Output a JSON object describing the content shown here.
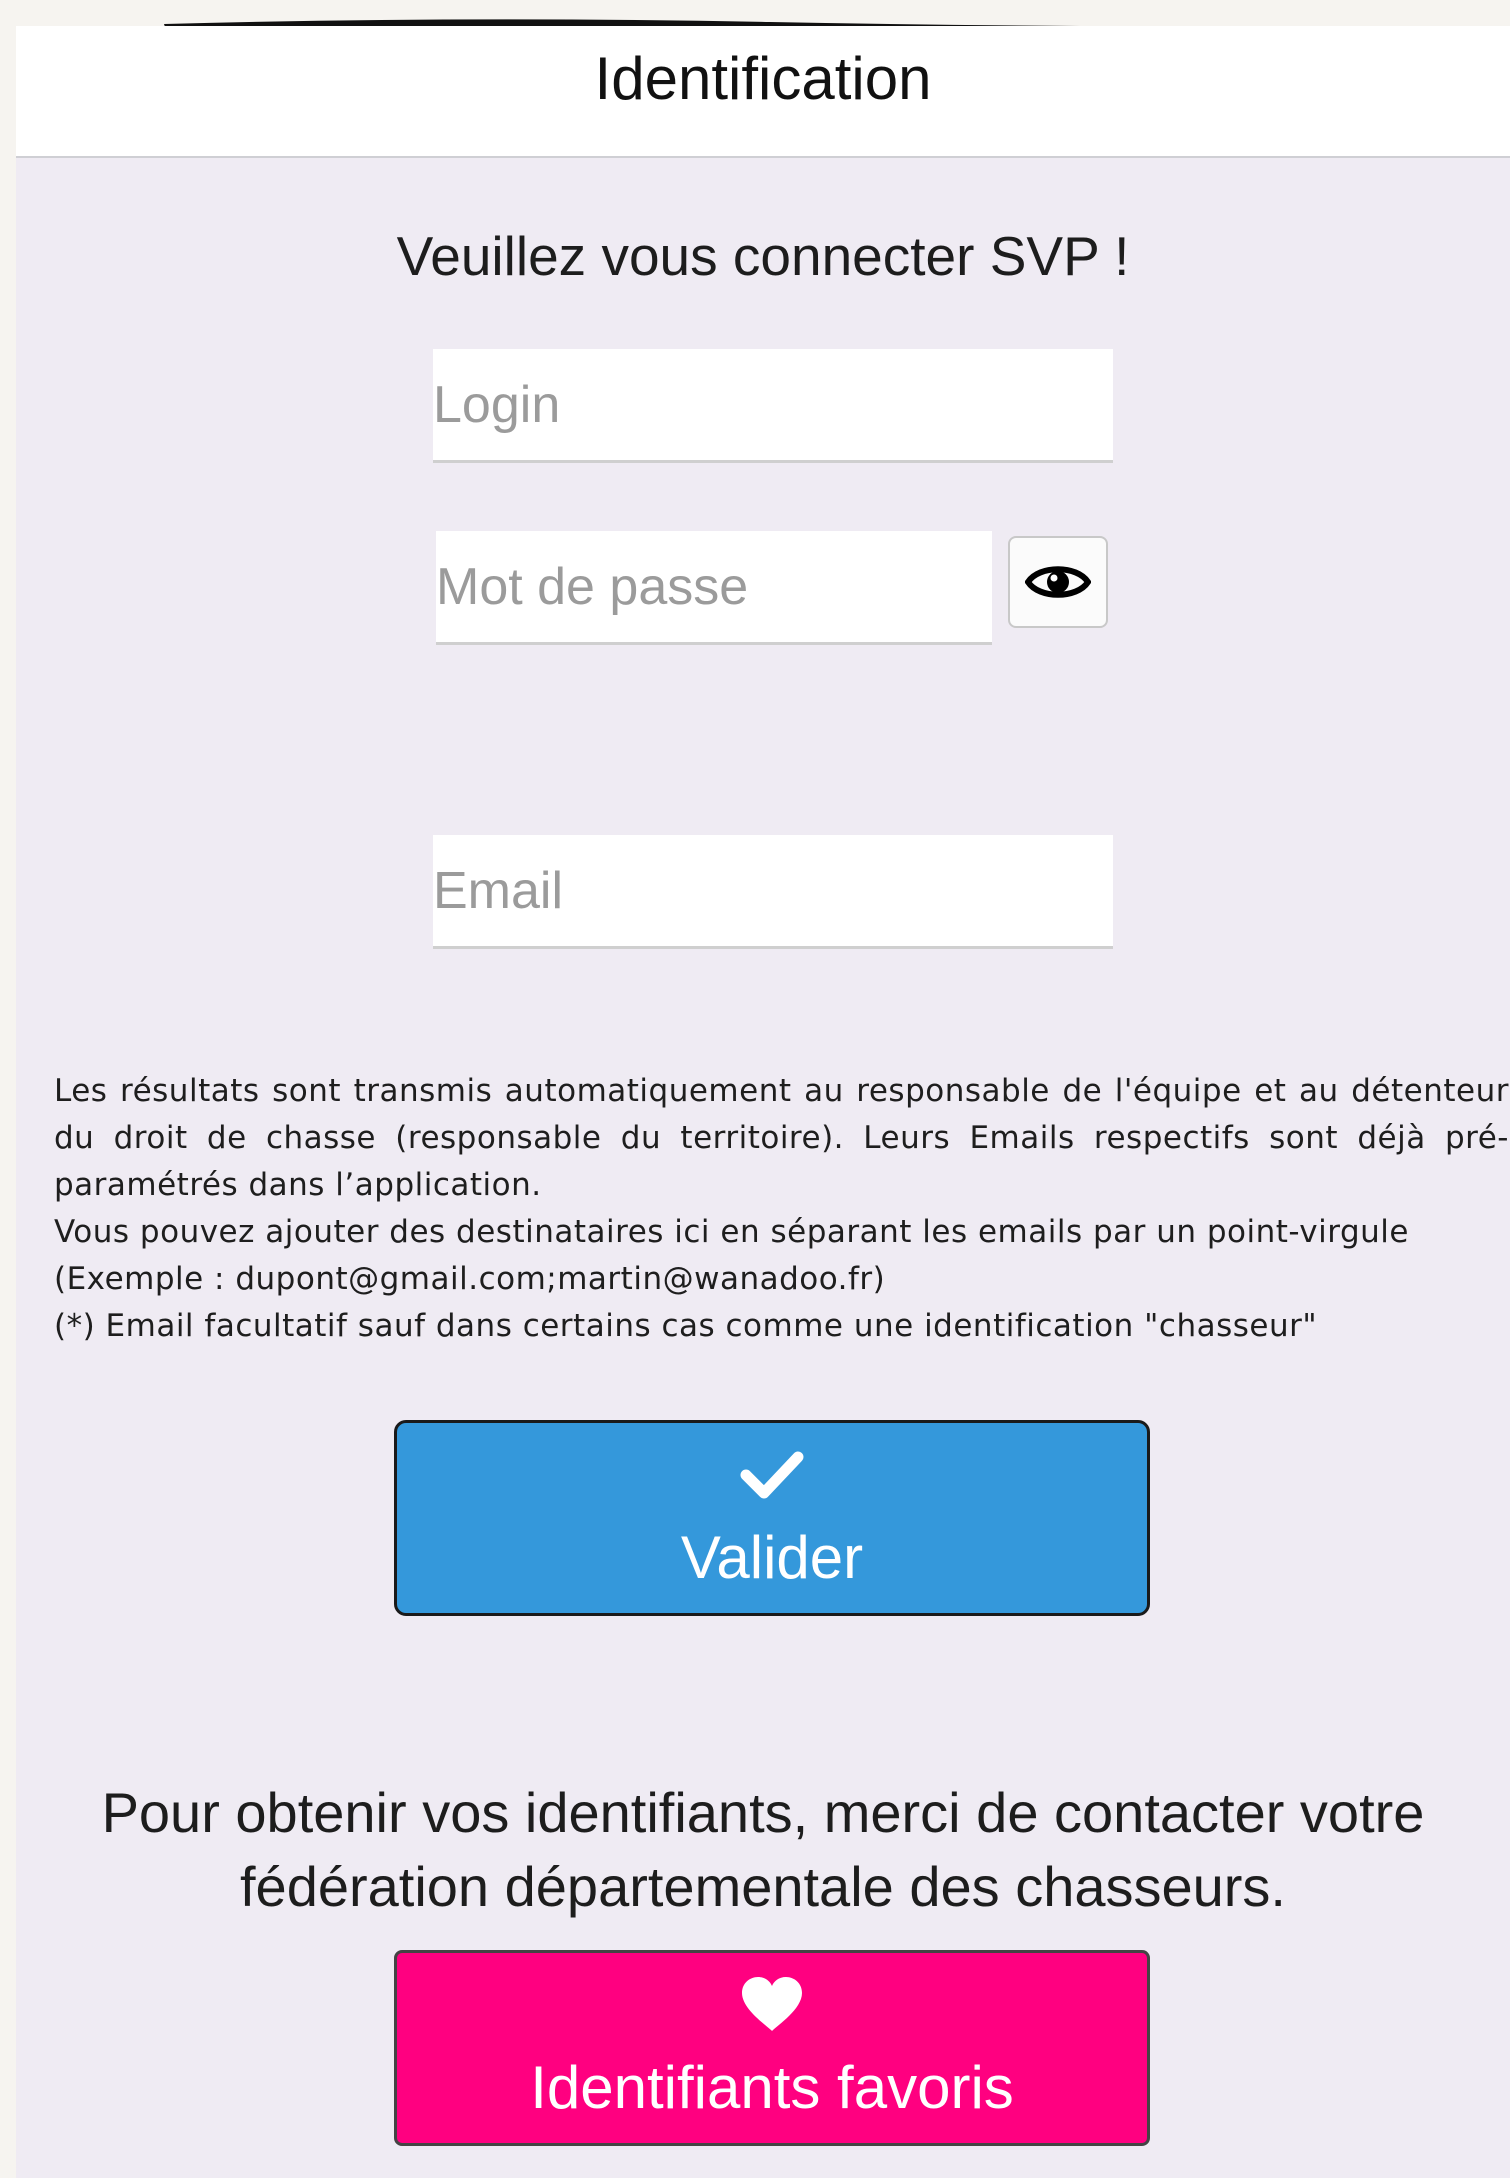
{
  "header": {
    "title": "Identification"
  },
  "form": {
    "prompt": "Veuillez vous connecter SVP !",
    "login_placeholder": "Login",
    "password_placeholder": "Mot de passe",
    "email_placeholder": "Email",
    "show_password_icon": "eye-icon"
  },
  "info": {
    "line1": "Les résultats sont transmis automatiquement au responsable de l'équipe et au détenteur du droit de chasse (responsable du territoire). Leurs Emails respectifs sont déjà pré-paramétrés dans l’application.",
    "line2": "Vous pouvez ajouter des destinataires ici en séparant les emails par un point-virgule (Exemple : dupont@gmail.com;martin@wanadoo.fr)",
    "line3": "(*) Email facultatif sauf dans certains cas comme une identification \"chasseur\""
  },
  "valider_button": {
    "label": "Valider",
    "icon": "check-icon",
    "color": "#3498db"
  },
  "contact_text": "Pour obtenir vos identifiants, merci de contacter votre fédération départementale des chasseurs.",
  "favoris_button": {
    "label": "Identifiants favoris",
    "icon": "heart-icon",
    "color": "#ff0080"
  }
}
